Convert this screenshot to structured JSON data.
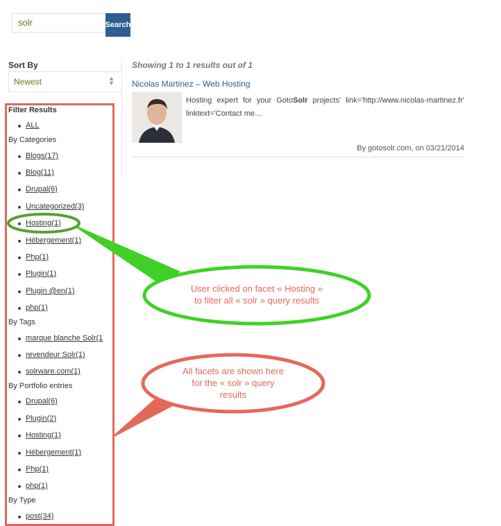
{
  "search": {
    "value": "solr",
    "button_label": "Search"
  },
  "sort": {
    "label": "Sort By",
    "selected": "Newest"
  },
  "results": {
    "summary": "Showing 1 to 1 results out of 1",
    "items": [
      {
        "title": "Nicolas Martinez – Web Hosting",
        "snippet_before": "Hosting expert for your Goto",
        "snippet_highlight": "Solr",
        "snippet_after": " projects' link='http://www.nicolas-martinez.fr' linktext='Contact me…",
        "meta": "By gotosolr.com, on 03/21/2014"
      }
    ]
  },
  "facets": {
    "title": "Filter Results",
    "all_label": "ALL",
    "groups": [
      {
        "label": "By Categories",
        "items": [
          "Blogs(17)",
          "Blog(11)",
          "Drupal(6)",
          "Uncategorized(3)",
          "Hosting(1)",
          "Hébergement(1)",
          "Php(1)",
          "Plugin(1)",
          "Plugin @en(1)",
          "php(1)"
        ]
      },
      {
        "label": "By Tags",
        "items": [
          "marque blanche Solr(1",
          "revendeur Solr(1)",
          "solrware.com(1)"
        ]
      },
      {
        "label": "By Portfolio entries",
        "items": [
          "Drupal(6)",
          "Plugin(2)",
          "Hosting(1)",
          "Hébergement(1)",
          "Php(1)",
          "php(1)"
        ]
      },
      {
        "label": "By Type",
        "items": [
          "post(34)"
        ]
      }
    ]
  },
  "annotations": {
    "green_callout": [
      "User clicked on facet « Hosting »",
      "to filter all « solr » query results"
    ],
    "red_callout": [
      "All facets are shown here",
      "for the « solr » query",
      "results"
    ],
    "colors": {
      "green": "#3fd127",
      "red": "#e4685a"
    }
  }
}
